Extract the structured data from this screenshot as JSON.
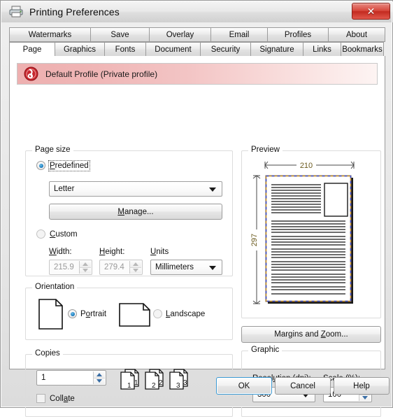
{
  "window": {
    "title": "Printing Preferences",
    "printer_icon": "printer-icon",
    "close_label": "✕"
  },
  "tabs": {
    "row1": [
      {
        "label": "Watermarks",
        "active": false
      },
      {
        "label": "Save",
        "active": false
      },
      {
        "label": "Overlay",
        "active": false
      },
      {
        "label": "Email",
        "active": false
      },
      {
        "label": "Profiles",
        "active": false
      },
      {
        "label": "About",
        "active": false
      }
    ],
    "row2": [
      {
        "label": "Page",
        "active": true
      },
      {
        "label": "Graphics",
        "active": false
      },
      {
        "label": "Fonts",
        "active": false
      },
      {
        "label": "Document",
        "active": false
      },
      {
        "label": "Security",
        "active": false
      },
      {
        "label": "Signature",
        "active": false
      },
      {
        "label": "Links",
        "active": false
      },
      {
        "label": "Bookmarks",
        "active": false
      }
    ]
  },
  "profile": {
    "icon": "profile-icon",
    "label": "Default Profile (Private profile)",
    "accent_color": "#c6262e",
    "banner_color": "#eeb0b0"
  },
  "page_size": {
    "title": "Page size",
    "predefined_label": "Predefined",
    "predefined_selected": true,
    "preset_value": "Letter",
    "manage_label": "Manage...",
    "custom_label": "Custom",
    "custom_selected": false,
    "width_label": "Width:",
    "width_value": "215.9",
    "height_label": "Height:",
    "height_value": "279.4",
    "units_label": "Units",
    "units_value": "Millimeters"
  },
  "orientation": {
    "title": "Orientation",
    "portrait_label": "Portrait",
    "portrait_selected": true,
    "landscape_label": "Landscape",
    "landscape_selected": false
  },
  "copies": {
    "title": "Copies",
    "count_value": "1",
    "collate_label": "Collate",
    "collate_checked": false,
    "stack_numbers": [
      "1",
      "2",
      "3"
    ]
  },
  "preview": {
    "title": "Preview",
    "width_dim": "210",
    "height_dim": "297",
    "margin_color": "#3b4fd0",
    "dim_text_color": "#6b5a1e"
  },
  "margins_button": {
    "label": "Margins and Zoom..."
  },
  "graphic": {
    "title": "Graphic",
    "resolution_label": "Resolution (dpi):",
    "resolution_value": "300",
    "scale_label": "Scale (%):",
    "scale_value": "100"
  },
  "dialog_buttons": {
    "ok": "OK",
    "cancel": "Cancel",
    "help": "Help"
  }
}
